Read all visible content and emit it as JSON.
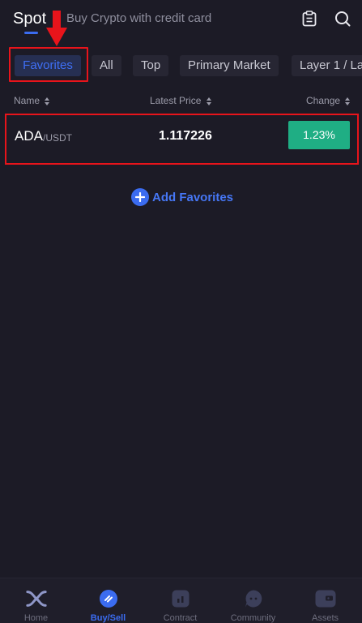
{
  "header": {
    "tabs": [
      {
        "label": "Spot",
        "active": true
      },
      {
        "label": "Buy Crypto with credit card",
        "active": false
      }
    ],
    "icons": [
      "clipboard-icon",
      "search-icon"
    ]
  },
  "filters": {
    "chips": [
      "Favorites",
      "All",
      "Top",
      "Primary Market",
      "Layer 1 / La"
    ],
    "active": "Favorites"
  },
  "columns": {
    "name": "Name",
    "price": "Latest Price",
    "change": "Change"
  },
  "rows": [
    {
      "base": "ADA",
      "quote": "/USDT",
      "price": "1.117226",
      "change": "1.23%"
    }
  ],
  "add_favorites": {
    "label": "Add Favorites"
  },
  "bottom_nav": [
    {
      "label": "Home",
      "icon": "home-logo-icon"
    },
    {
      "label": "Buy/Sell",
      "icon": "buy-sell-icon",
      "active": true
    },
    {
      "label": "Contract",
      "icon": "contract-icon"
    },
    {
      "label": "Community",
      "icon": "community-icon"
    },
    {
      "label": "Assets",
      "icon": "wallet-icon"
    }
  ],
  "colors": {
    "background": "#1c1b26",
    "accent": "#3b6cf0",
    "positive": "#1fae84",
    "annotation": "#e8141b"
  }
}
